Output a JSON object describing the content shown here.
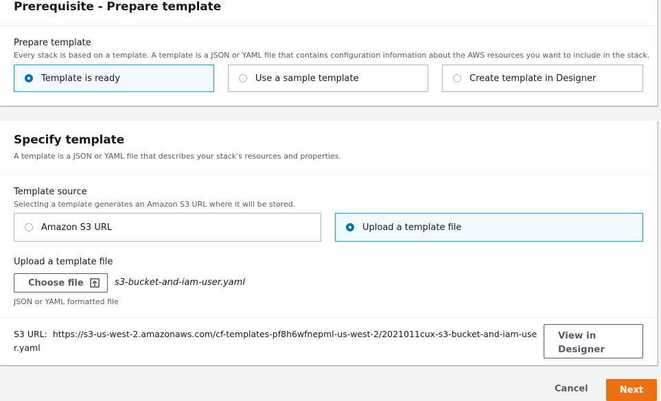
{
  "prerequisite": {
    "title": "Prerequisite - Prepare template",
    "field_label": "Prepare template",
    "field_description": "Every stack is based on a template. A template is a JSON or YAML file that contains configuration information about the AWS resources you want to include in the stack.",
    "options": [
      {
        "label": "Template is ready",
        "selected": true
      },
      {
        "label": "Use a sample template",
        "selected": false
      },
      {
        "label": "Create template in Designer",
        "selected": false
      }
    ]
  },
  "specify": {
    "title": "Specify template",
    "description": "A template is a JSON or YAML file that describes your stack's resources and properties.",
    "source_label": "Template source",
    "source_description": "Selecting a template generates an Amazon S3 URL where it will be stored.",
    "source_options": [
      {
        "label": "Amazon S3 URL",
        "selected": false
      },
      {
        "label": "Upload a template file",
        "selected": true
      }
    ],
    "upload_label": "Upload a template file",
    "choose_file_label": "Choose file",
    "file_name": "s3-bucket-and-iam-user.yaml",
    "upload_hint": "JSON or YAML formatted file",
    "s3_url_label": "S3 URL:",
    "s3_url_value": "https://s3-us-west-2.amazonaws.com/cf-templates-pf8h6wfnepml-us-west-2/2021011cux-s3-bucket-and-iam-user.yaml",
    "view_designer_label": "View in Designer"
  },
  "footer": {
    "cancel_label": "Cancel",
    "next_label": "Next"
  },
  "colors": {
    "accent": "#0073bb",
    "selected_border": "#00a1c9",
    "primary_button": "#ec7211"
  }
}
